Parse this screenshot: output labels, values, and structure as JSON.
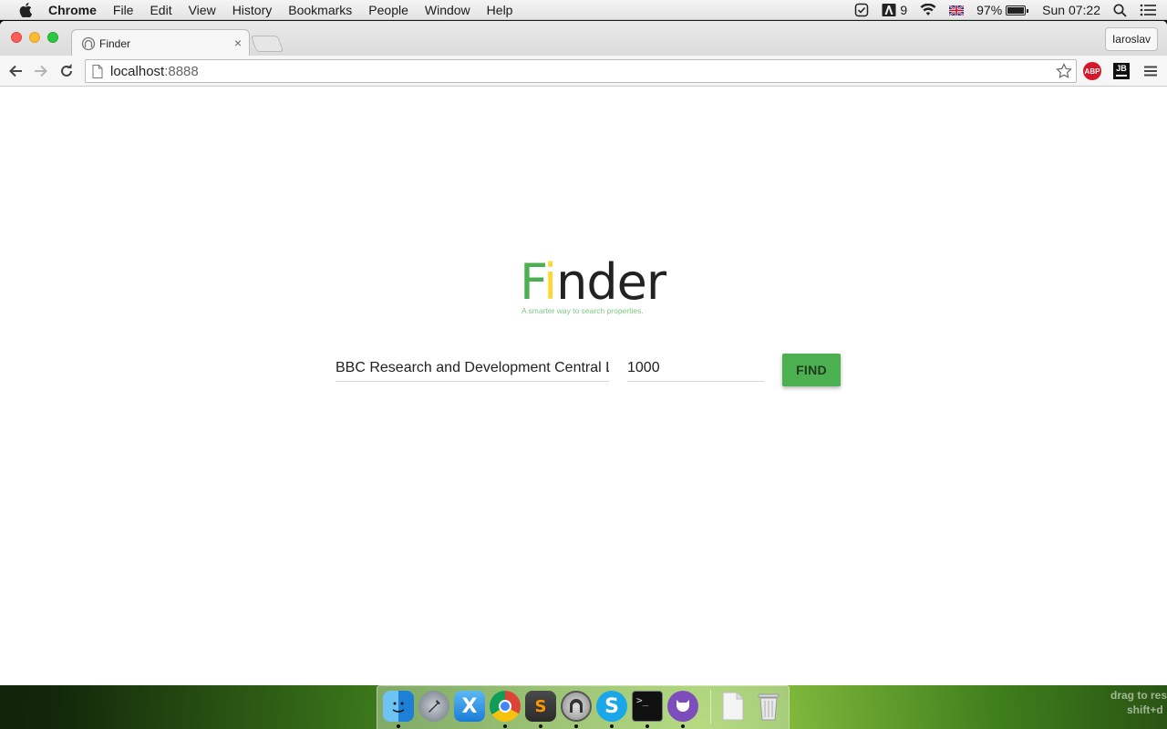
{
  "menubar": {
    "app_name": "Chrome",
    "menus": [
      "File",
      "Edit",
      "View",
      "History",
      "Bookmarks",
      "People",
      "Window",
      "Help"
    ],
    "status": {
      "adobe_count": "9",
      "battery": "97%",
      "battery_level": 0.97,
      "clock": "Sun 07:22"
    }
  },
  "browser": {
    "tab_title": "Finder",
    "profile_name": "Iaroslav",
    "url_host": "localhost",
    "url_port": ":8888",
    "extensions": {
      "abp_label": "ABP",
      "jb_label": "JB"
    }
  },
  "page": {
    "logo": {
      "f": "F",
      "i": "i",
      "rest": "nder"
    },
    "tagline": "A smarter way to search properties.",
    "query_value": "BBC Research and Development Central Lab",
    "radius_value": "1000",
    "find_label": "FIND",
    "brand_color": "#4caf50",
    "accent_color": "#fdd835"
  },
  "dock": {
    "apps": [
      "finder-icon",
      "launchpad-icon",
      "xcode-icon",
      "chrome-icon",
      "sublime-text-icon",
      "sequel-pro-icon",
      "skype-icon",
      "terminal-icon",
      "github-desktop-icon",
      "document-icon",
      "trash-icon"
    ]
  },
  "resize_hint": {
    "line1": "drag to res",
    "line2": "shift+d"
  }
}
